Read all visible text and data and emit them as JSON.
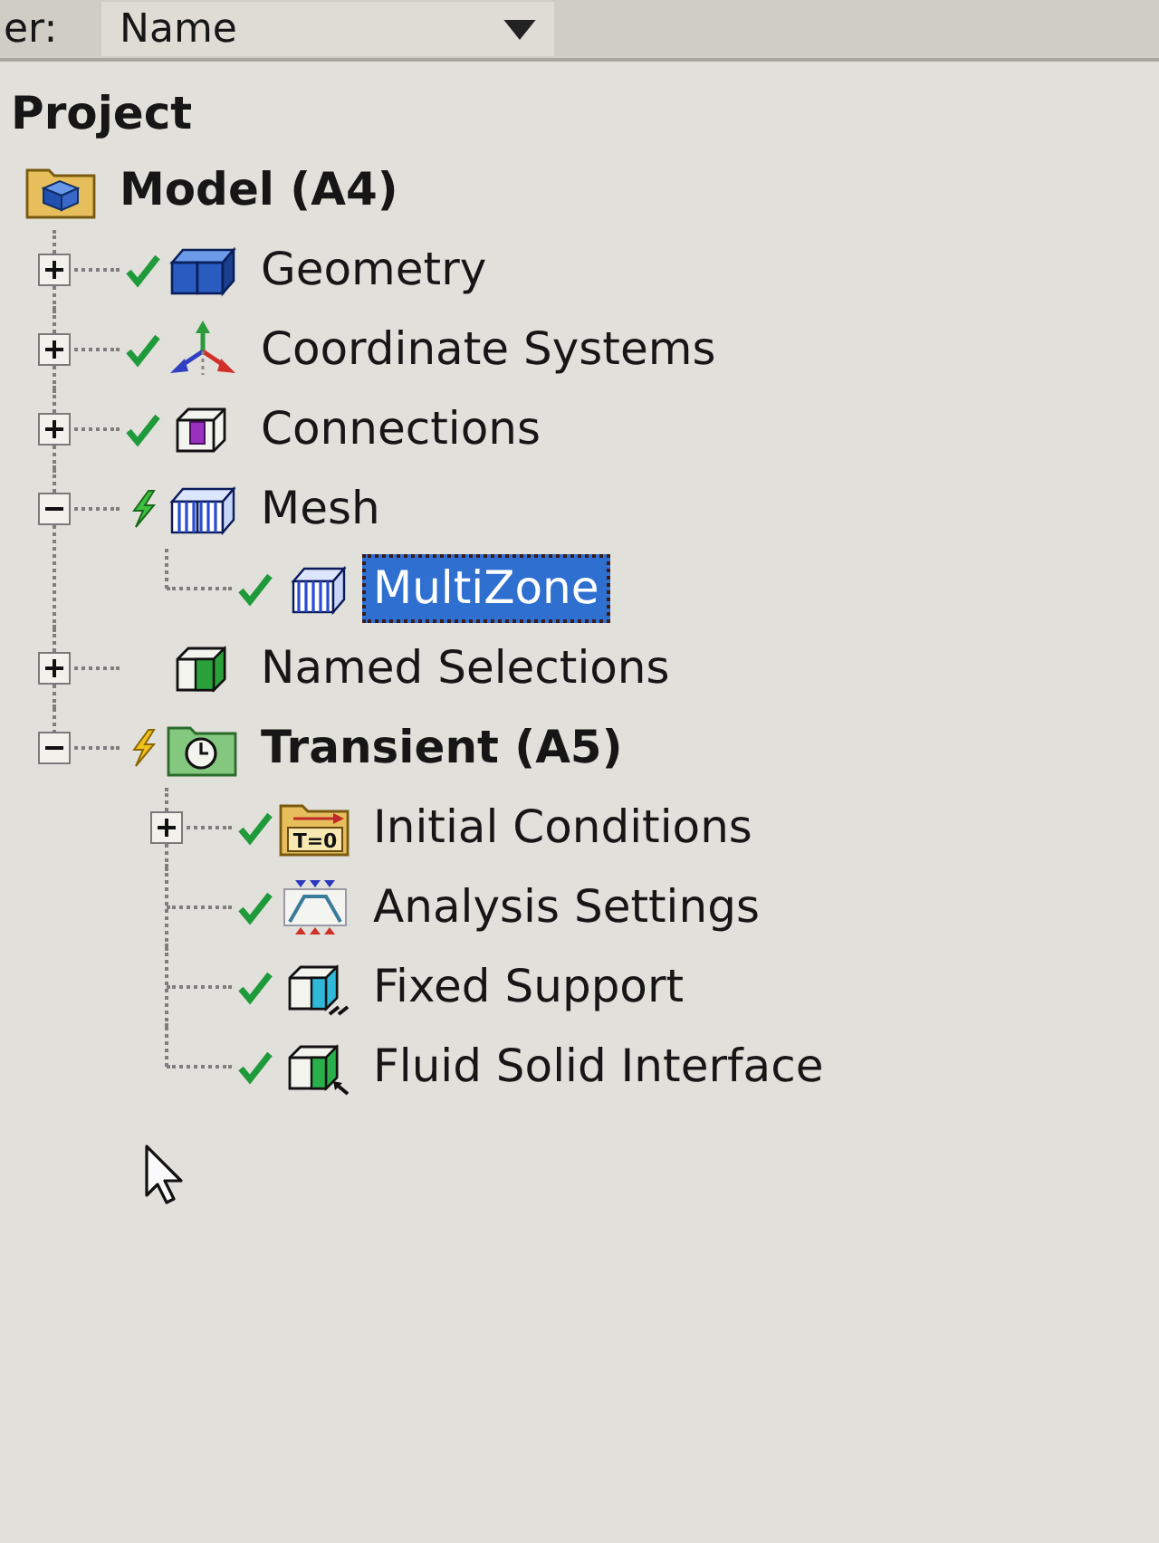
{
  "filter": {
    "label": "er:",
    "value": "Name"
  },
  "tree": {
    "title": "Project",
    "items": [
      {
        "label": "Model (A4)",
        "kind": "model",
        "selected": false,
        "children": [
          {
            "label": "Geometry",
            "kind": "geometry",
            "expanded": false,
            "status": {
              "kind": "check"
            },
            "selected": false
          },
          {
            "label": "Coordinate Systems",
            "kind": "coordinates",
            "expanded": false,
            "status": {
              "kind": "check"
            },
            "selected": false
          },
          {
            "label": "Connections",
            "kind": "connections",
            "expanded": false,
            "status": {
              "kind": "check"
            },
            "selected": false
          },
          {
            "label": "Mesh",
            "kind": "mesh",
            "expanded": true,
            "status": {
              "kind": "update"
            },
            "selected": false,
            "children": [
              {
                "label": "MultiZone",
                "kind": "mesh-method",
                "status": {
                  "kind": "check"
                },
                "selected": true
              }
            ]
          },
          {
            "label": "Named Selections",
            "kind": "named-selections",
            "expanded": false,
            "selected": false
          },
          {
            "label": "Transient (A5)",
            "kind": "transient",
            "expanded": true,
            "status": {
              "kind": "solve"
            },
            "selected": false,
            "children": [
              {
                "label": "Initial Conditions",
                "kind": "initial-conditions",
                "icon_text": "T=0",
                "expanded": false,
                "status": {
                  "kind": "check"
                },
                "selected": false
              },
              {
                "label": "Analysis Settings",
                "kind": "analysis-settings",
                "status": {
                  "kind": "check"
                },
                "selected": false
              },
              {
                "label": "Fixed Support",
                "kind": "fixed-support",
                "status": {
                  "kind": "check"
                },
                "selected": false
              },
              {
                "label": "Fluid Solid Interface",
                "kind": "fluid-solid-interface",
                "status": {
                  "kind": "check"
                },
                "selected": false
              }
            ]
          }
        ]
      }
    ]
  }
}
